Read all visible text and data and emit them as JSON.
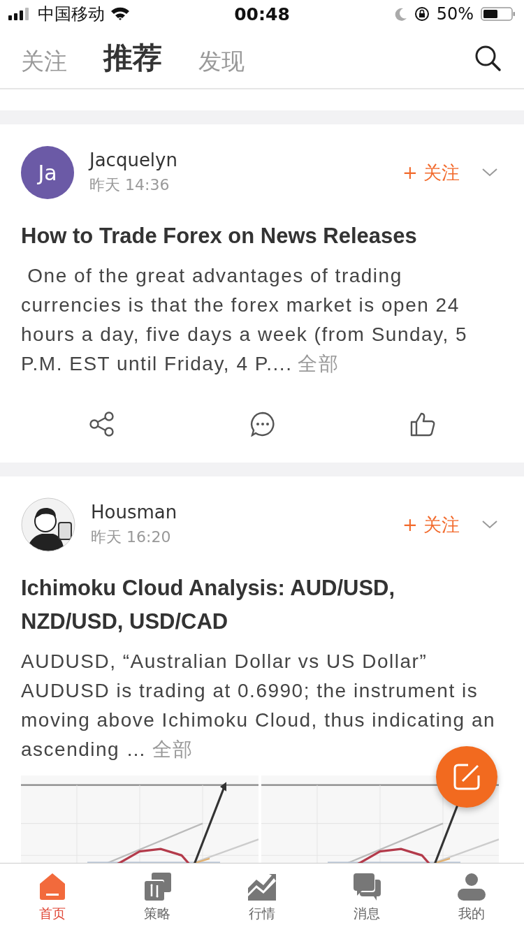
{
  "status_bar": {
    "carrier": "中国移动",
    "time": "00:48",
    "battery": "50%"
  },
  "top_tabs": [
    {
      "label": "关注",
      "selected": false
    },
    {
      "label": "推荐",
      "selected": true
    },
    {
      "label": "发现",
      "selected": false
    }
  ],
  "posts": [
    {
      "author": "Jacquelyn",
      "avatar": {
        "kind": "initials",
        "text": "Ja",
        "color": "#6b5aa6"
      },
      "time": "昨天 14:36",
      "follow": "+ 关注",
      "title": "How to Trade Forex on News Releases",
      "body": " One of the great advantages of trading currencies is that the forex market is open 24 hours a day, five days a week (from Sunday, 5 P.M. EST until Friday, 4 P....",
      "more": "全部",
      "has_actions": true,
      "has_images": false
    },
    {
      "author": "Housman",
      "time": "昨天 16:20",
      "follow": "+ 关注",
      "title": "Ichimoku Cloud Analysis: AUD/USD, NZD/USD, USD/CAD",
      "body": "AUDUSD, “Australian Dollar vs US Dollar” AUDUSD is trading at 0.6990; the instrument is moving above Ichimoku Cloud, thus indicating an ascending …",
      "more": "全部",
      "has_actions": false,
      "has_images": true
    }
  ],
  "bottom_tabs": [
    {
      "label": "首页",
      "selected": true
    },
    {
      "label": "策略",
      "selected": false
    },
    {
      "label": "行情",
      "selected": false
    },
    {
      "label": "消息",
      "selected": false
    },
    {
      "label": "我的",
      "selected": false
    }
  ]
}
